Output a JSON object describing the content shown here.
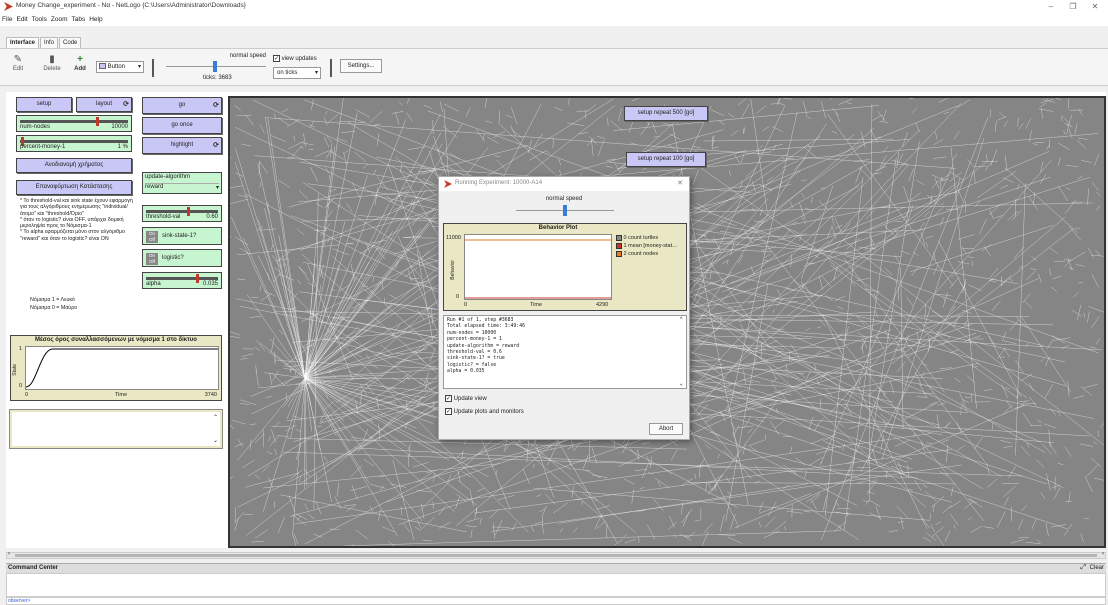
{
  "window": {
    "title": "Money Change_experiment - Να - NetLogo {C:\\Users\\Administrator\\Downloads}",
    "minimize": "–",
    "maximize": "❐",
    "close": "✕"
  },
  "menu": [
    "File",
    "Edit",
    "Tools",
    "Zoom",
    "Tabs",
    "Help"
  ],
  "tabs": [
    "Interface",
    "Info",
    "Code"
  ],
  "toolbar": {
    "edit": "Edit",
    "delete": "Delete",
    "add": "Add",
    "widget_type": "Button",
    "speed_label": "normal speed",
    "ticks": "ticks: 3683",
    "view_updates": "view updates",
    "update_mode": "on ticks",
    "settings": "Settings..."
  },
  "buttons": {
    "setup": "setup",
    "layout": "layout",
    "go": "go",
    "go_once": "go once",
    "highlight": "highlight",
    "reset_money": "Ανοδιανομή χρήματος",
    "restore_state": "Επαναφόρτωση Κατάστασης",
    "setup_repeat_500": "setup repeat 500 [go]",
    "setup_repeat_100": "setup repeat 100 [go]"
  },
  "sliders": {
    "num_nodes": {
      "label": "num-nodes",
      "value": "10000",
      "fraction": 0.72
    },
    "percent_money": {
      "label": "percent-money-1",
      "value": "1 %",
      "fraction": 0.01
    },
    "threshold": {
      "label": "threshold-val",
      "value": "0.60",
      "fraction": 0.6
    },
    "alpha": {
      "label": "alpha",
      "value": "0.035",
      "fraction": 0.72
    }
  },
  "chooser": {
    "label": "update-algorithm",
    "value": "reward"
  },
  "switches": {
    "sink_state": {
      "label": "sink-state-1?",
      "on": "On",
      "off": "Off"
    },
    "logistic": {
      "label": "logistic?",
      "on": "On",
      "off": "Off"
    }
  },
  "notes": {
    "info": "* Το threshold-val και sink state έχουν εφαρμογή για τους αλγόριθμους ενημέρωσης \"individual/άτομο\" και \"threshold/Όριο\"\n* όταν το logistic? είναι OFF, υπάρχει δομική μεροληψία προς το Νόμισμα-1\n* Το alpha εφαρμόζεται μόνο στον αλγόριθμο \"reward\" και όταν το logistic? είναι ON",
    "legend1": "Νόμισμα 1 = Λευκό",
    "legend0": "Νόμισμα 0 = Μαύρο"
  },
  "plot_main": {
    "title": "Μέσος όρος συναλλασσόμενων με νόμισμα 1 στο δίκτυο",
    "ylabel": "State",
    "xlabel": "Time",
    "ymax": "1",
    "ymin": "0",
    "xmin": "0",
    "xmax": "3740"
  },
  "dialog": {
    "title": "Running Experiment: 10000-A14",
    "speed_label": "normal speed",
    "plot": {
      "title": "Behavior Plot",
      "ymax": "11000",
      "ymin": "0",
      "xmin": "0",
      "xmax": "4290",
      "xlabel": "Time",
      "ylabel": "Behavior",
      "legend": [
        "0 count turtles",
        "1 mean [money-stat...",
        "2 count nodes"
      ]
    },
    "log": [
      "Run #1 of 1, step #3683",
      "Total elapsed time: 3:49:46",
      "num-nodes = 10000",
      "percent-money-1 = 1",
      "update-algorithm = reward",
      "threshold-val = 0.6",
      "sink-state-1? = true",
      "logistic? = false",
      "alpha = 0.035"
    ],
    "update_view": "Update view",
    "update_plots": "Update plots and monitors",
    "abort": "Abort"
  },
  "command_center": {
    "title": "Command Center",
    "clear": "Clear",
    "observer": "observer>"
  },
  "colors": {
    "button": "#c8c7f5",
    "slider": "#c7f5d0",
    "plot": "#eae8c4",
    "world": "#858585",
    "series_count_turtles": "#888888",
    "series_mean_money": "#c0392b",
    "series_count_nodes": "#e67e22"
  }
}
